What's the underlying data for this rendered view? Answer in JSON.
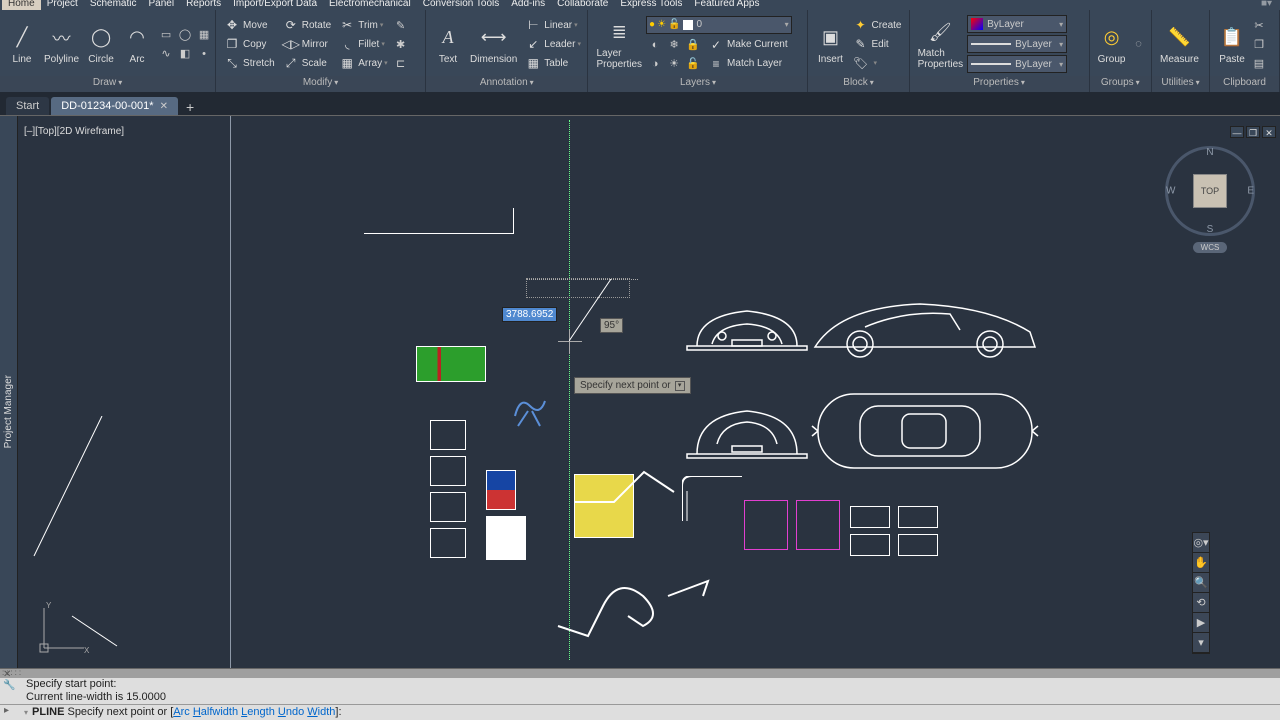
{
  "menu": {
    "items": [
      "Home",
      "Project",
      "Schematic",
      "Panel",
      "Reports",
      "Import/Export Data",
      "Electromechanical",
      "Conversion Tools",
      "Add-ins",
      "Collaborate",
      "Express Tools",
      "Featured Apps"
    ],
    "active": 0
  },
  "ribbon": {
    "draw": {
      "label": "Draw",
      "line": "Line",
      "polyline": "Polyline",
      "circle": "Circle",
      "arc": "Arc"
    },
    "modify": {
      "label": "Modify",
      "move": "Move",
      "rotate": "Rotate",
      "trim": "Trim",
      "copy": "Copy",
      "mirror": "Mirror",
      "fillet": "Fillet",
      "stretch": "Stretch",
      "scale": "Scale",
      "array": "Array"
    },
    "annotation": {
      "label": "Annotation",
      "text": "Text",
      "dimension": "Dimension",
      "linear": "Linear",
      "leader": "Leader",
      "table": "Table"
    },
    "layers": {
      "label": "Layers",
      "props": "Layer\nProperties",
      "combo_value": "0",
      "make_current": "Make Current",
      "match_layer": "Match Layer"
    },
    "block": {
      "label": "Block",
      "insert": "Insert",
      "create": "Create",
      "edit": "Edit"
    },
    "properties": {
      "label": "Properties",
      "match": "Match\nProperties",
      "color": "ByLayer",
      "line1": "ByLayer",
      "line2": "ByLayer"
    },
    "groups": {
      "label": "Groups",
      "group": "Group"
    },
    "utilities": {
      "label": "Utilities",
      "measure": "Measure"
    },
    "clipboard": {
      "label": "Clipboard",
      "paste": "Paste"
    }
  },
  "tabs": {
    "start": "Start",
    "doc": "DD-01234-00-001*"
  },
  "viewport": {
    "controls": "[–][Top][2D Wireframe]"
  },
  "sidebar": {
    "label": "Project Manager"
  },
  "viewcube": {
    "face": "TOP",
    "wcs": "WCS",
    "n": "N",
    "s": "S",
    "e": "E",
    "w": "W"
  },
  "dynamic": {
    "dist": "3788.6952",
    "angle": "95°",
    "prompt": "Specify next point or"
  },
  "cmd": {
    "history1": "Specify start point:",
    "history2": "Current line-width is 15.0000",
    "cmd_name": "PLINE",
    "prompt_pre": "Specify next point or [",
    "opts": [
      {
        "u": "A",
        "rest": "rc"
      },
      {
        "u": "H",
        "rest": "alfwidth"
      },
      {
        "u": "L",
        "rest": "ength"
      },
      {
        "u": "U",
        "rest": "ndo"
      },
      {
        "u": "W",
        "rest": "idth"
      }
    ],
    "prompt_post": "]:"
  }
}
